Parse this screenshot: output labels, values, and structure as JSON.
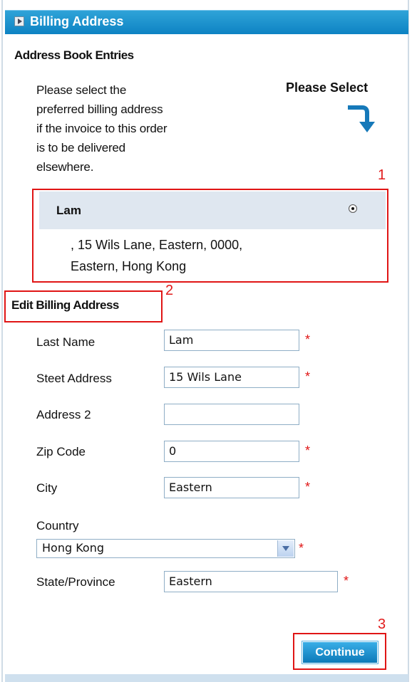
{
  "header": {
    "title": "Billing Address",
    "icon": "arrow-right-icon"
  },
  "address_book": {
    "title": "Address Book Entries",
    "instruction_lines": [
      "Please select the",
      "preferred billing address",
      "if the invoice to this order",
      "is to be delivered",
      "elsewhere."
    ],
    "please_select": "Please Select",
    "entry": {
      "name": "Lam",
      "line1": ", 15 Wils Lane, Eastern, 0000,",
      "line2": "Eastern, Hong Kong",
      "selected": true
    }
  },
  "edit": {
    "title": "Edit Billing Address",
    "fields": {
      "last_name": {
        "label": "Last Name",
        "value": "Lam"
      },
      "street": {
        "label": "Steet Address",
        "value": "15 Wils Lane"
      },
      "address2": {
        "label": "Address 2",
        "value": ""
      },
      "zip": {
        "label": "Zip Code",
        "value": "0"
      },
      "city": {
        "label": "City",
        "value": "Eastern"
      },
      "country": {
        "label": "Country",
        "value": "Hong Kong"
      },
      "state": {
        "label": "State/Province",
        "value": "Eastern"
      }
    },
    "required_mark": "*"
  },
  "continue_label": "Continue",
  "annotations": {
    "one": "1",
    "two": "2",
    "three": "3"
  },
  "colors": {
    "header": "#0d83c3",
    "annotation": "#e01515"
  }
}
